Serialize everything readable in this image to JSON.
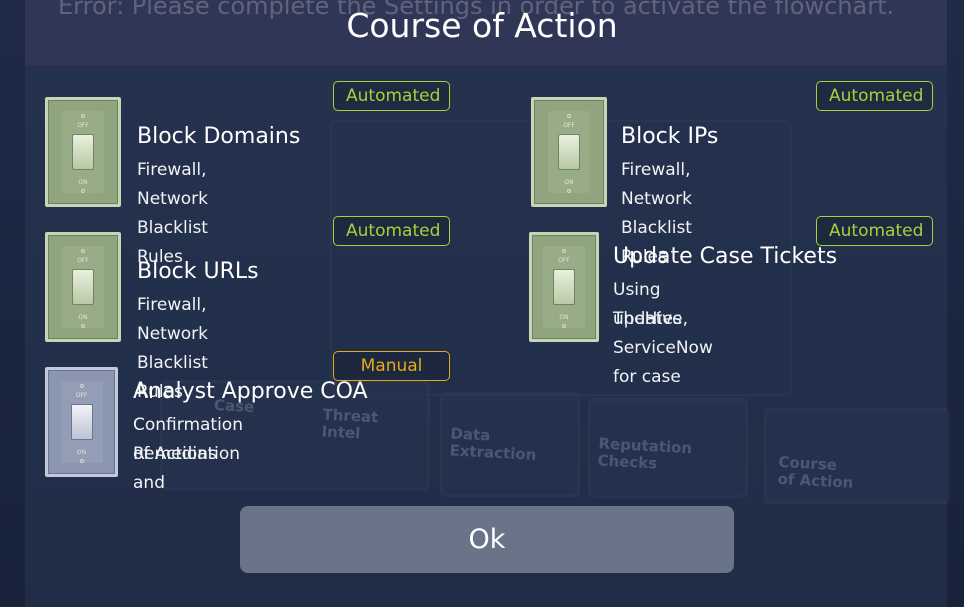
{
  "background": {
    "banner_text": "Error: Please complete the Settings in order to activate the flowchart.",
    "tiles": [
      {
        "label": "Case"
      },
      {
        "label": "Threat Intel"
      },
      {
        "label": "Data Extraction"
      },
      {
        "label": "Reputation Checks"
      },
      {
        "label": "Course of Action"
      }
    ]
  },
  "dialog": {
    "title": "Course of Action",
    "items": [
      {
        "name": "Block Domains",
        "description": "Firewall, Network Blacklist Rules",
        "mode": "Automated"
      },
      {
        "name": "Block IPs",
        "description": "Firewall, Network Blacklist Rules",
        "mode": "Automated"
      },
      {
        "name": "Block URLs",
        "description": "Firewall, Network Blacklist Rules",
        "mode": "Automated"
      },
      {
        "name": "Update Case Tickets",
        "description_line1": "Using TheHive, ServiceNow for case",
        "description_line2": "updates",
        "mode": "Automated"
      },
      {
        "name": "Analyst Approve COA",
        "description_line1": "Confirmation of Actions and",
        "description_line2": "Remediation",
        "mode": "Manual"
      }
    ],
    "switch_labels": {
      "off": "OFF",
      "on": "ON"
    },
    "ok_label": "Ok"
  },
  "colors": {
    "automated": "#a3d23b",
    "manual": "#e5a91b",
    "switch_automated": "#8fa57d",
    "switch_manual": "#8a95b0"
  }
}
